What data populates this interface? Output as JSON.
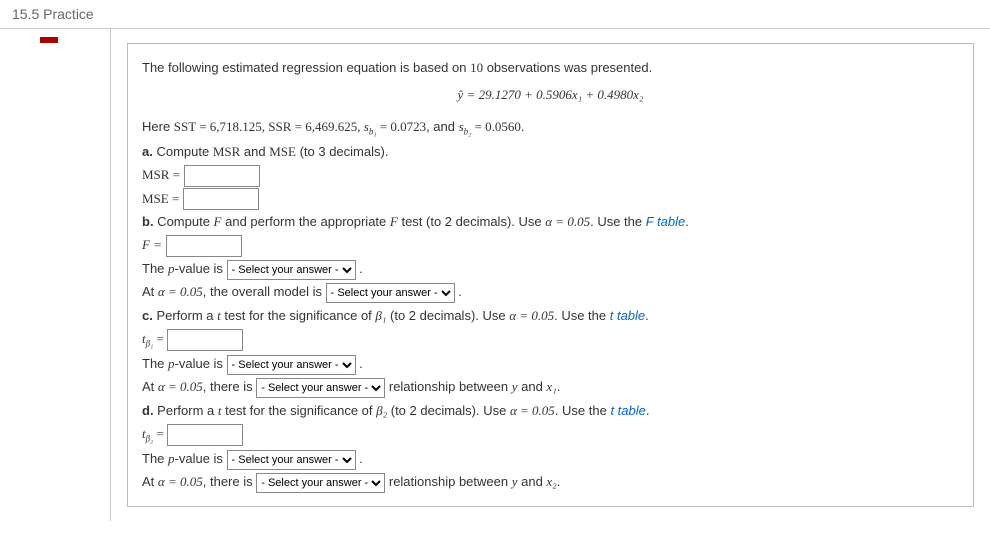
{
  "header": {
    "title": "15.5 Practice"
  },
  "intro": {
    "line1_a": "The following estimated regression equation is based on ",
    "line1_n": "10",
    "line1_b": " observations was presented.",
    "equation": "ŷ = 29.1270 + 0.5906x₁ + 0.4980x₂",
    "line2_a": "Here ",
    "sst_label": "SST = ",
    "sst_val": "6,718.125",
    "ssr_label": "SSR = ",
    "ssr_val": "6,469.625",
    "sb1_label": "s",
    "sb1_sub": "b₁",
    "sb1_eq": " = ",
    "sb1_val": "0.0723",
    "and": ", and ",
    "sb2_label": "s",
    "sb2_sub": "b₂",
    "sb2_eq": " = ",
    "sb2_val": "0.0560",
    "period": "."
  },
  "a": {
    "q": "a.",
    "text_a": " Compute ",
    "msr": "MSR",
    "text_b": " and ",
    "mse": "MSE",
    "text_c": " (to 3 decimals).",
    "msr_label": "MSR =",
    "mse_label": "MSE ="
  },
  "b": {
    "q": "b.",
    "text_a": " Compute ",
    "F": "F",
    "text_b": " and perform the appropriate ",
    "text_c": " test (to 2 decimals). Use ",
    "alpha": "α = 0.05",
    "text_d": ". Use the ",
    "ftable": "F table",
    "dot": ".",
    "f_label": "F =",
    "pvalue_a": "The ",
    "pvalue_p": "p",
    "pvalue_b": "-value is ",
    "at_a": "At ",
    "at_b": ", the overall model is "
  },
  "c": {
    "q": "c.",
    "text_a": " Perform a ",
    "t": "t",
    "text_b": " test for the significance of ",
    "beta": "β₁",
    "text_c": " (to 2 decimals). Use ",
    "alpha": "α = 0.05",
    "text_d": ". Use the ",
    "ttable": "t table",
    "dot": ".",
    "tlabel_a": "t",
    "tlabel_sub": "β₁",
    "tlabel_b": " =",
    "at_b": ", there is ",
    "rel": " relationship between ",
    "y": "y",
    "and": " and ",
    "x": "x₁",
    "dot2": "."
  },
  "d": {
    "q": "d.",
    "text_a": " Perform a ",
    "t": "t",
    "text_b": " test for the significance of ",
    "beta": "β₂",
    "text_c": " (to 2 decimals). Use ",
    "alpha": "α = 0.05",
    "text_d": ". Use the ",
    "ttable": "t table",
    "dot": ".",
    "tlabel_a": "t",
    "tlabel_sub": "β₂",
    "tlabel_b": " =",
    "at_b": ", there is ",
    "rel": " relationship between ",
    "y": "y",
    "and": " and ",
    "x": "x₂",
    "dot2": "."
  },
  "select_placeholder": "- Select your answer -"
}
